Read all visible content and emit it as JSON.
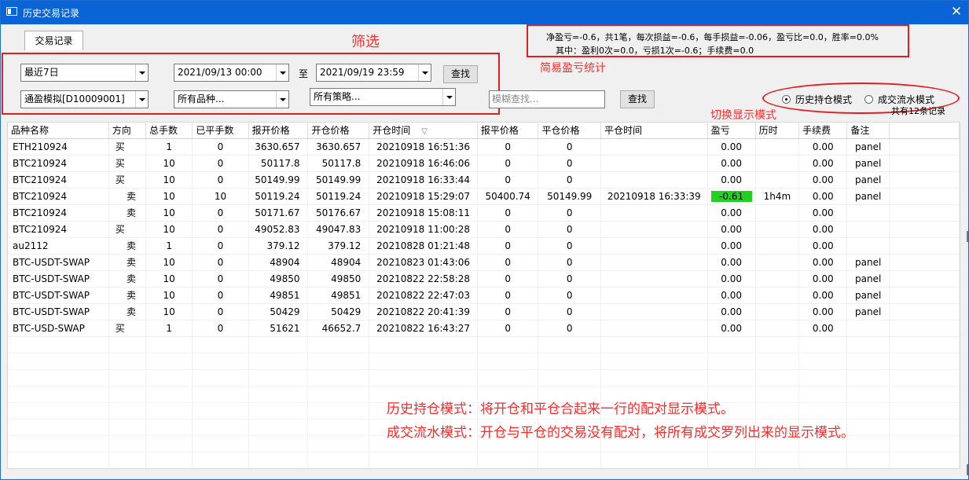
{
  "window": {
    "title": "历史交易记录",
    "close_glyph": "✕"
  },
  "tab": {
    "label": "交易记录"
  },
  "filters": {
    "period": "最近7日",
    "start_time": "2021/09/13 00:00",
    "to_label": "至",
    "end_time": "2021/09/19 23:59",
    "search_button": "查找",
    "account": "通盈模拟[D10009001]",
    "products": "所有品种...",
    "strategies": "所有策略...",
    "fuzzy_placeholder": "模糊查找...",
    "search_button2": "查找"
  },
  "stats": {
    "line1": "净盈亏=-0.6，共1笔，每次损益=-0.6，每手损益=-0.06，盈亏比=0.0，胜率=0.0%",
    "line2": "其中：盈利0次=0.0，亏损1次=-0.6；手续费=0.0"
  },
  "modes": {
    "history_position": "历史持仓模式",
    "trade_flow": "成交流水模式",
    "selected": "history_position",
    "record_count": "共有12条记录"
  },
  "annotations": {
    "filter": "筛选",
    "stats": "简易盈亏统计",
    "switch": "切换显示模式",
    "note1": "历史持仓模式：将开仓和平仓合起来一行的配对显示模式。",
    "note2": "成交流水模式：开仓与平仓的交易没有配对，将所有成交罗列出来的显示模式。",
    "color": "#ff2a2a"
  },
  "table": {
    "columns": [
      "品种名称",
      "方向",
      "总手数",
      "已平手数",
      "报开价格",
      "开仓价格",
      "开仓时间",
      "报平价格",
      "平仓价格",
      "平仓时间",
      "盈亏",
      "历时",
      "手续费",
      "备注"
    ],
    "rows": [
      [
        "ETH210924",
        "买",
        "1",
        "0",
        "3630.657",
        "3630.657",
        "20210918 16:51:36",
        "0",
        "0",
        "",
        "0.00",
        "",
        "0.00",
        "panel"
      ],
      [
        "BTC210924",
        "买",
        "10",
        "0",
        "50117.8",
        "50117.8",
        "20210918 16:46:06",
        "0",
        "0",
        "",
        "0.00",
        "",
        "0.00",
        "panel"
      ],
      [
        "BTC210924",
        "买",
        "10",
        "0",
        "50149.99",
        "50149.99",
        "20210918 16:33:44",
        "0",
        "0",
        "",
        "0.00",
        "",
        "0.00",
        "panel"
      ],
      [
        "BTC210924",
        "卖",
        "10",
        "10",
        "50119.24",
        "50119.24",
        "20210918 15:29:07",
        "50400.74",
        "50149.99",
        "20210918 16:33:39",
        "-0.61",
        "1h4m",
        "0.00",
        "panel"
      ],
      [
        "BTC210924",
        "卖",
        "10",
        "0",
        "50171.67",
        "50176.67",
        "20210918 15:08:11",
        "0",
        "0",
        "",
        "0.00",
        "",
        "0.00",
        ""
      ],
      [
        "BTC210924",
        "买",
        "10",
        "0",
        "49052.83",
        "49047.83",
        "20210918 11:00:28",
        "0",
        "0",
        "",
        "0.00",
        "",
        "0.00",
        ""
      ],
      [
        "au2112",
        "卖",
        "1",
        "0",
        "379.12",
        "379.12",
        "20210828 01:21:48",
        "0",
        "0",
        "",
        "0.00",
        "",
        "0.00",
        ""
      ],
      [
        "BTC-USDT-SWAP",
        "卖",
        "10",
        "0",
        "48904",
        "48904",
        "20210823 01:43:06",
        "0",
        "0",
        "",
        "0.00",
        "",
        "0.00",
        "panel"
      ],
      [
        "BTC-USDT-SWAP",
        "卖",
        "10",
        "0",
        "49850",
        "49850",
        "20210822 22:58:28",
        "0",
        "0",
        "",
        "0.00",
        "",
        "0.00",
        "panel"
      ],
      [
        "BTC-USDT-SWAP",
        "卖",
        "10",
        "0",
        "49851",
        "49851",
        "20210822 22:47:03",
        "0",
        "0",
        "",
        "0.00",
        "",
        "0.00",
        "panel"
      ],
      [
        "BTC-USDT-SWAP",
        "卖",
        "10",
        "0",
        "50429",
        "50429",
        "20210822 20:41:39",
        "0",
        "0",
        "",
        "0.00",
        "",
        "0.00",
        "panel"
      ],
      [
        "BTC-USD-SWAP",
        "买",
        "1",
        "0",
        "51621",
        "46652.7",
        "20210822 16:43:27",
        "0",
        "0",
        "",
        "0.00",
        "",
        "0.00",
        ""
      ]
    ],
    "loss_highlight_color": "#22d022"
  }
}
